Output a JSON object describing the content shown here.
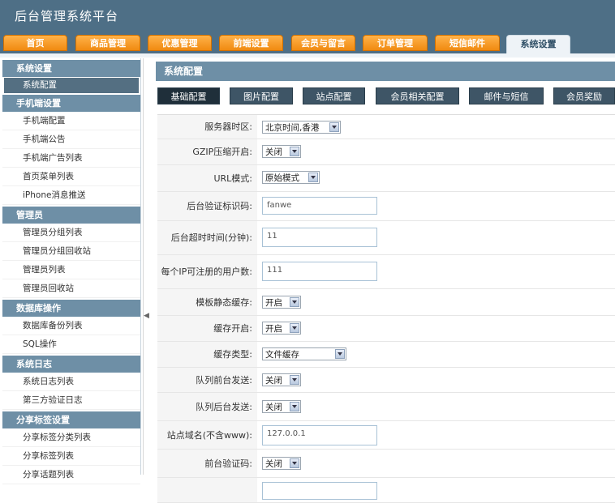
{
  "app_title": "后台管理系统平台",
  "nav": [
    {
      "label": "首页"
    },
    {
      "label": "商品管理"
    },
    {
      "label": "优惠管理"
    },
    {
      "label": "前端设置"
    },
    {
      "label": "会员与留言"
    },
    {
      "label": "订单管理"
    },
    {
      "label": "短信邮件"
    },
    {
      "label": "系统设置"
    }
  ],
  "sidebar": {
    "groups": [
      {
        "title": "系统设置",
        "items": [
          "系统配置"
        ]
      },
      {
        "title": "手机端设置",
        "items": [
          "手机端配置",
          "手机端公告",
          "手机端广告列表",
          "首页菜单列表",
          "iPhone消息推送"
        ]
      },
      {
        "title": "管理员",
        "items": [
          "管理员分组列表",
          "管理员分组回收站",
          "管理员列表",
          "管理员回收站"
        ]
      },
      {
        "title": "数据库操作",
        "items": [
          "数据库备份列表",
          "SQL操作"
        ]
      },
      {
        "title": "系统日志",
        "items": [
          "系统日志列表",
          "第三方验证日志"
        ]
      },
      {
        "title": "分享标签设置",
        "items": [
          "分享标签分类列表",
          "分享标签列表",
          "分享话题列表"
        ]
      }
    ]
  },
  "page_title": "系统配置",
  "subtabs": [
    {
      "label": "基础配置"
    },
    {
      "label": "图片配置"
    },
    {
      "label": "站点配置"
    },
    {
      "label": "会员相关配置"
    },
    {
      "label": "邮件与短信"
    },
    {
      "label": "会员奖励"
    }
  ],
  "form": [
    {
      "label": "服务器时区:",
      "value": "北京时间,香港"
    },
    {
      "label": "GZIP压缩开启:",
      "value": "关闭"
    },
    {
      "label": "URL模式:",
      "value": "原始模式"
    },
    {
      "label": "后台验证标识码:",
      "value": "fanwe"
    },
    {
      "label": "后台超时时间(分钟):",
      "value": "11"
    },
    {
      "label": "每个IP可注册的用户数:",
      "value": "111"
    },
    {
      "label": "模板静态缓存:",
      "value": "开启"
    },
    {
      "label": "缓存开启:",
      "value": "开启"
    },
    {
      "label": "缓存类型:",
      "value": "文件缓存"
    },
    {
      "label": "队列前台发送:",
      "value": "关闭"
    },
    {
      "label": "队列后台发送:",
      "value": "关闭"
    },
    {
      "label": "站点域名(不含www):",
      "value": "127.0.0.1"
    },
    {
      "label": "前台验证码:",
      "value": "关闭"
    },
    {
      "label": "",
      "value": ""
    }
  ],
  "icons": {
    "dropdown": "chevron-down-icon",
    "collapse": "collapse-arrow-icon"
  }
}
